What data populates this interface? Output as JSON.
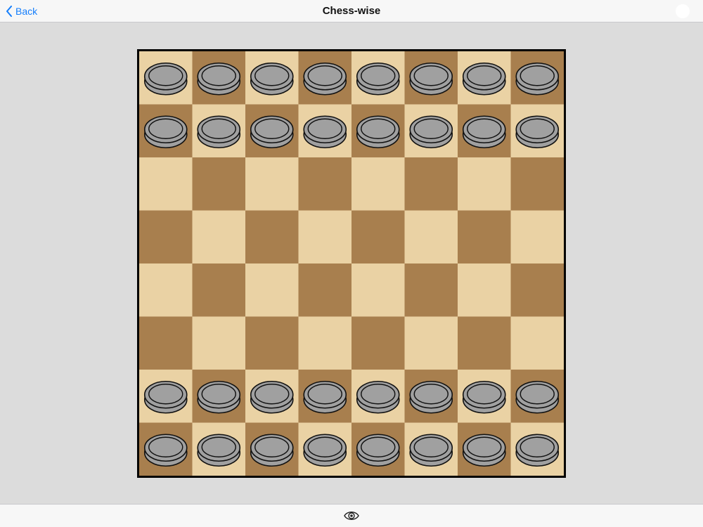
{
  "navbar": {
    "back_label": "Back",
    "title": "Chess-wise"
  },
  "board": {
    "rows": 8,
    "cols": 8,
    "light_square_color": "#ead2a4",
    "dark_square_color": "#a87f4e",
    "piece_color": "#a0a0a0",
    "piece_outline_color": "#111111",
    "pieces": [
      {
        "row": 0,
        "col": 0
      },
      {
        "row": 0,
        "col": 1
      },
      {
        "row": 0,
        "col": 2
      },
      {
        "row": 0,
        "col": 3
      },
      {
        "row": 0,
        "col": 4
      },
      {
        "row": 0,
        "col": 5
      },
      {
        "row": 0,
        "col": 6
      },
      {
        "row": 0,
        "col": 7
      },
      {
        "row": 1,
        "col": 0
      },
      {
        "row": 1,
        "col": 1
      },
      {
        "row": 1,
        "col": 2
      },
      {
        "row": 1,
        "col": 3
      },
      {
        "row": 1,
        "col": 4
      },
      {
        "row": 1,
        "col": 5
      },
      {
        "row": 1,
        "col": 6
      },
      {
        "row": 1,
        "col": 7
      },
      {
        "row": 6,
        "col": 0
      },
      {
        "row": 6,
        "col": 1
      },
      {
        "row": 6,
        "col": 2
      },
      {
        "row": 6,
        "col": 3
      },
      {
        "row": 6,
        "col": 4
      },
      {
        "row": 6,
        "col": 5
      },
      {
        "row": 6,
        "col": 6
      },
      {
        "row": 6,
        "col": 7
      },
      {
        "row": 7,
        "col": 0
      },
      {
        "row": 7,
        "col": 1
      },
      {
        "row": 7,
        "col": 2
      },
      {
        "row": 7,
        "col": 3
      },
      {
        "row": 7,
        "col": 4
      },
      {
        "row": 7,
        "col": 5
      },
      {
        "row": 7,
        "col": 6
      },
      {
        "row": 7,
        "col": 7
      }
    ]
  },
  "toolbar": {
    "icon": "eye-icon"
  }
}
